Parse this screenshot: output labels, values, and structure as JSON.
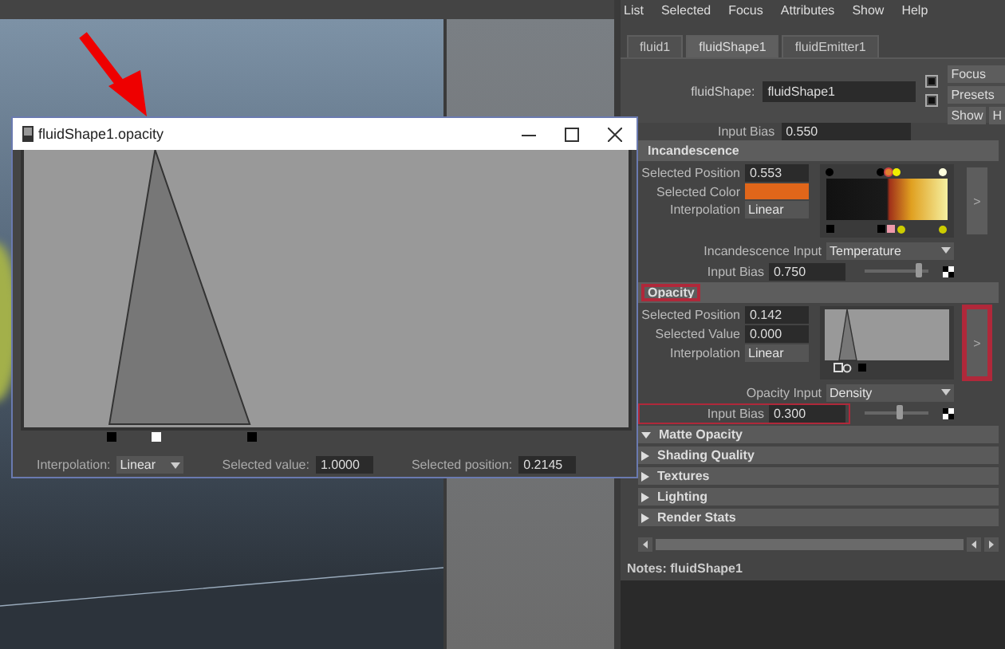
{
  "menu": [
    "List",
    "Selected",
    "Focus",
    "Attributes",
    "Show",
    "Help"
  ],
  "tabs": [
    {
      "label": "fluid1",
      "selected": false
    },
    {
      "label": "fluidShape1",
      "selected": true
    },
    {
      "label": "fluidEmitter1",
      "selected": false
    }
  ],
  "node": {
    "label": "fluidShape:",
    "value": "fluidShape1",
    "buttons": [
      "Focus",
      "Presets",
      "Show",
      "H"
    ]
  },
  "partial_row": {
    "label": "Input Bias",
    "value": "0.550"
  },
  "ramps": [
    {
      "title": "Incandescence",
      "title_highlighted": false,
      "kind": "color",
      "fields": [
        {
          "label": "Selected Position",
          "kind": "text",
          "value": "0.553"
        },
        {
          "label": "Selected Color",
          "kind": "swatch",
          "color": "#e0661a"
        },
        {
          "label": "Interpolation",
          "kind": "dropdown",
          "value": "Linear"
        }
      ],
      "ramp_button": {
        "label": ">",
        "highlighted": false
      },
      "input": {
        "label": "Incandescence Input",
        "value": "Temperature"
      },
      "bias": {
        "label": "Input Bias",
        "value": "0.750",
        "level": 0.85,
        "highlighted": false
      }
    },
    {
      "title": "Opacity",
      "title_highlighted": true,
      "kind": "curve",
      "fields": [
        {
          "label": "Selected Position",
          "kind": "text",
          "value": "0.142"
        },
        {
          "label": "Selected Value",
          "kind": "text",
          "value": "0.000"
        },
        {
          "label": "Interpolation",
          "kind": "dropdown",
          "value": "Linear"
        }
      ],
      "ramp_button": {
        "label": ">",
        "highlighted": true
      },
      "input": {
        "label": "Opacity Input",
        "value": "Density"
      },
      "bias": {
        "label": "Input Bias",
        "value": "0.300",
        "level": 0.55,
        "highlighted": true
      }
    }
  ],
  "sections": [
    {
      "title": "Matte Opacity",
      "expanded": true
    },
    {
      "title": "Shading Quality",
      "expanded": false
    },
    {
      "title": "Textures",
      "expanded": false
    },
    {
      "title": "Lighting",
      "expanded": false
    },
    {
      "title": "Render Stats",
      "expanded": false
    }
  ],
  "notes": "Notes:  fluidShape1",
  "float_window": {
    "title": "fluidShape1.opacity",
    "markers": [
      {
        "selected": false
      },
      {
        "selected": true
      },
      {
        "selected": false
      }
    ],
    "interpolation": {
      "label": "Interpolation:",
      "value": "Linear"
    },
    "selected_value": {
      "label": "Selected value:",
      "value": "1.0000"
    },
    "selected_position": {
      "label": "Selected position:",
      "value": "0.2145"
    }
  }
}
